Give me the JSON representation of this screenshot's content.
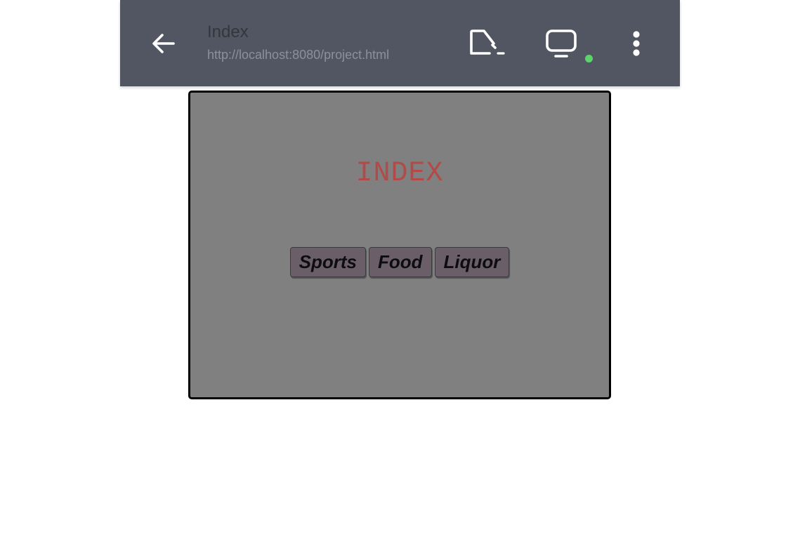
{
  "appbar": {
    "title": "Index",
    "url": "http://localhost:8080/project.html",
    "icons": {
      "back": "back-arrow-icon",
      "cast": "cast-icon",
      "display": "monitor-icon",
      "menu": "more-vert-icon"
    },
    "background_color": "#525662",
    "status_dot_color": "#5fd36b"
  },
  "page": {
    "heading": "INDEX",
    "heading_color": "#b24a48",
    "frame_background": "#808080",
    "nav": [
      {
        "label": "Sports"
      },
      {
        "label": "Food"
      },
      {
        "label": "Liquor"
      }
    ]
  }
}
